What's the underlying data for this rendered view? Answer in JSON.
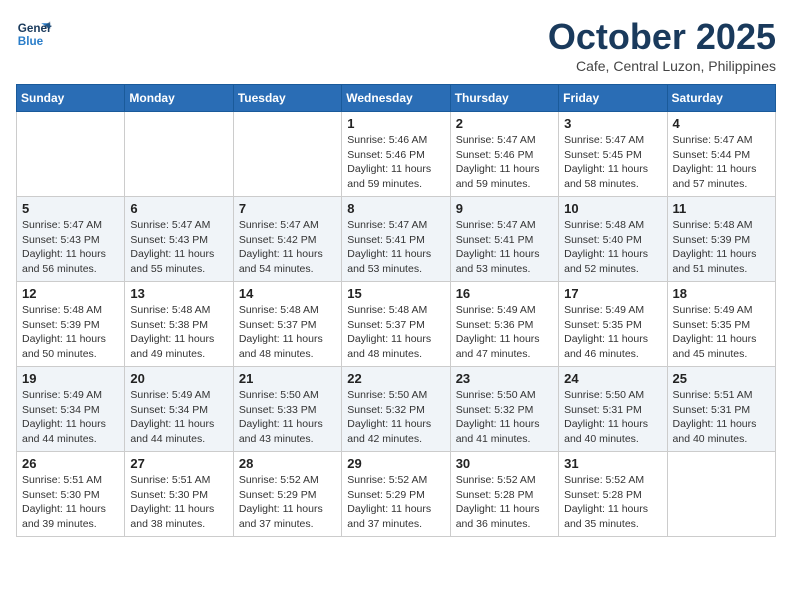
{
  "logo": {
    "line1": "General",
    "line2": "Blue"
  },
  "title": "October 2025",
  "location": "Cafe, Central Luzon, Philippines",
  "weekdays": [
    "Sunday",
    "Monday",
    "Tuesday",
    "Wednesday",
    "Thursday",
    "Friday",
    "Saturday"
  ],
  "weeks": [
    [
      {
        "day": "",
        "sunrise": "",
        "sunset": "",
        "daylight": ""
      },
      {
        "day": "",
        "sunrise": "",
        "sunset": "",
        "daylight": ""
      },
      {
        "day": "",
        "sunrise": "",
        "sunset": "",
        "daylight": ""
      },
      {
        "day": "1",
        "sunrise": "Sunrise: 5:46 AM",
        "sunset": "Sunset: 5:46 PM",
        "daylight": "Daylight: 11 hours and 59 minutes."
      },
      {
        "day": "2",
        "sunrise": "Sunrise: 5:47 AM",
        "sunset": "Sunset: 5:46 PM",
        "daylight": "Daylight: 11 hours and 59 minutes."
      },
      {
        "day": "3",
        "sunrise": "Sunrise: 5:47 AM",
        "sunset": "Sunset: 5:45 PM",
        "daylight": "Daylight: 11 hours and 58 minutes."
      },
      {
        "day": "4",
        "sunrise": "Sunrise: 5:47 AM",
        "sunset": "Sunset: 5:44 PM",
        "daylight": "Daylight: 11 hours and 57 minutes."
      }
    ],
    [
      {
        "day": "5",
        "sunrise": "Sunrise: 5:47 AM",
        "sunset": "Sunset: 5:43 PM",
        "daylight": "Daylight: 11 hours and 56 minutes."
      },
      {
        "day": "6",
        "sunrise": "Sunrise: 5:47 AM",
        "sunset": "Sunset: 5:43 PM",
        "daylight": "Daylight: 11 hours and 55 minutes."
      },
      {
        "day": "7",
        "sunrise": "Sunrise: 5:47 AM",
        "sunset": "Sunset: 5:42 PM",
        "daylight": "Daylight: 11 hours and 54 minutes."
      },
      {
        "day": "8",
        "sunrise": "Sunrise: 5:47 AM",
        "sunset": "Sunset: 5:41 PM",
        "daylight": "Daylight: 11 hours and 53 minutes."
      },
      {
        "day": "9",
        "sunrise": "Sunrise: 5:47 AM",
        "sunset": "Sunset: 5:41 PM",
        "daylight": "Daylight: 11 hours and 53 minutes."
      },
      {
        "day": "10",
        "sunrise": "Sunrise: 5:48 AM",
        "sunset": "Sunset: 5:40 PM",
        "daylight": "Daylight: 11 hours and 52 minutes."
      },
      {
        "day": "11",
        "sunrise": "Sunrise: 5:48 AM",
        "sunset": "Sunset: 5:39 PM",
        "daylight": "Daylight: 11 hours and 51 minutes."
      }
    ],
    [
      {
        "day": "12",
        "sunrise": "Sunrise: 5:48 AM",
        "sunset": "Sunset: 5:39 PM",
        "daylight": "Daylight: 11 hours and 50 minutes."
      },
      {
        "day": "13",
        "sunrise": "Sunrise: 5:48 AM",
        "sunset": "Sunset: 5:38 PM",
        "daylight": "Daylight: 11 hours and 49 minutes."
      },
      {
        "day": "14",
        "sunrise": "Sunrise: 5:48 AM",
        "sunset": "Sunset: 5:37 PM",
        "daylight": "Daylight: 11 hours and 48 minutes."
      },
      {
        "day": "15",
        "sunrise": "Sunrise: 5:48 AM",
        "sunset": "Sunset: 5:37 PM",
        "daylight": "Daylight: 11 hours and 48 minutes."
      },
      {
        "day": "16",
        "sunrise": "Sunrise: 5:49 AM",
        "sunset": "Sunset: 5:36 PM",
        "daylight": "Daylight: 11 hours and 47 minutes."
      },
      {
        "day": "17",
        "sunrise": "Sunrise: 5:49 AM",
        "sunset": "Sunset: 5:35 PM",
        "daylight": "Daylight: 11 hours and 46 minutes."
      },
      {
        "day": "18",
        "sunrise": "Sunrise: 5:49 AM",
        "sunset": "Sunset: 5:35 PM",
        "daylight": "Daylight: 11 hours and 45 minutes."
      }
    ],
    [
      {
        "day": "19",
        "sunrise": "Sunrise: 5:49 AM",
        "sunset": "Sunset: 5:34 PM",
        "daylight": "Daylight: 11 hours and 44 minutes."
      },
      {
        "day": "20",
        "sunrise": "Sunrise: 5:49 AM",
        "sunset": "Sunset: 5:34 PM",
        "daylight": "Daylight: 11 hours and 44 minutes."
      },
      {
        "day": "21",
        "sunrise": "Sunrise: 5:50 AM",
        "sunset": "Sunset: 5:33 PM",
        "daylight": "Daylight: 11 hours and 43 minutes."
      },
      {
        "day": "22",
        "sunrise": "Sunrise: 5:50 AM",
        "sunset": "Sunset: 5:32 PM",
        "daylight": "Daylight: 11 hours and 42 minutes."
      },
      {
        "day": "23",
        "sunrise": "Sunrise: 5:50 AM",
        "sunset": "Sunset: 5:32 PM",
        "daylight": "Daylight: 11 hours and 41 minutes."
      },
      {
        "day": "24",
        "sunrise": "Sunrise: 5:50 AM",
        "sunset": "Sunset: 5:31 PM",
        "daylight": "Daylight: 11 hours and 40 minutes."
      },
      {
        "day": "25",
        "sunrise": "Sunrise: 5:51 AM",
        "sunset": "Sunset: 5:31 PM",
        "daylight": "Daylight: 11 hours and 40 minutes."
      }
    ],
    [
      {
        "day": "26",
        "sunrise": "Sunrise: 5:51 AM",
        "sunset": "Sunset: 5:30 PM",
        "daylight": "Daylight: 11 hours and 39 minutes."
      },
      {
        "day": "27",
        "sunrise": "Sunrise: 5:51 AM",
        "sunset": "Sunset: 5:30 PM",
        "daylight": "Daylight: 11 hours and 38 minutes."
      },
      {
        "day": "28",
        "sunrise": "Sunrise: 5:52 AM",
        "sunset": "Sunset: 5:29 PM",
        "daylight": "Daylight: 11 hours and 37 minutes."
      },
      {
        "day": "29",
        "sunrise": "Sunrise: 5:52 AM",
        "sunset": "Sunset: 5:29 PM",
        "daylight": "Daylight: 11 hours and 37 minutes."
      },
      {
        "day": "30",
        "sunrise": "Sunrise: 5:52 AM",
        "sunset": "Sunset: 5:28 PM",
        "daylight": "Daylight: 11 hours and 36 minutes."
      },
      {
        "day": "31",
        "sunrise": "Sunrise: 5:52 AM",
        "sunset": "Sunset: 5:28 PM",
        "daylight": "Daylight: 11 hours and 35 minutes."
      },
      {
        "day": "",
        "sunrise": "",
        "sunset": "",
        "daylight": ""
      }
    ]
  ]
}
